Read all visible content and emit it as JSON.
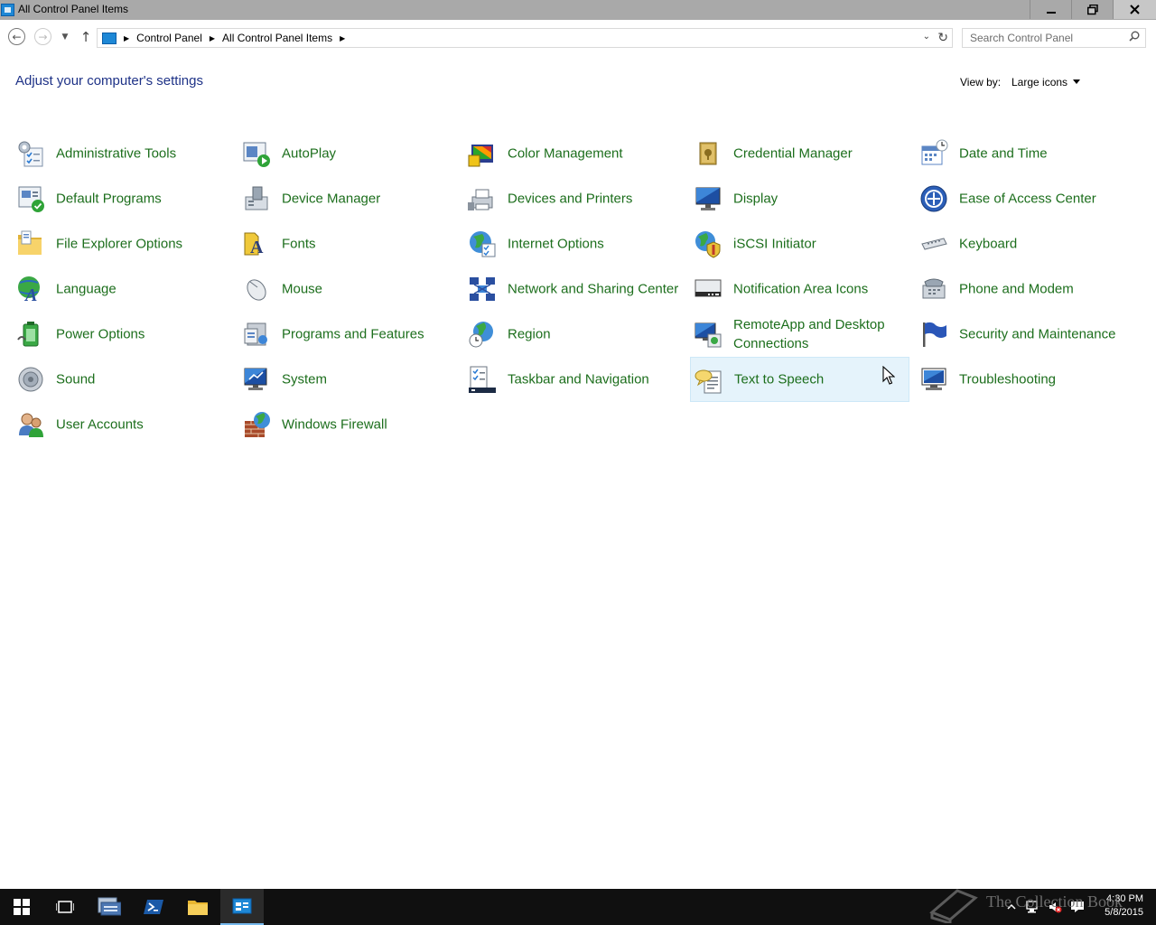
{
  "window": {
    "title": "All Control Panel Items",
    "minimize_glyph": "▁",
    "maximize_glyph": "❐",
    "close_glyph": "✕"
  },
  "address": {
    "crumbs": [
      "Control Panel",
      "All Control Panel Items"
    ],
    "search_placeholder": "Search Control Panel"
  },
  "header": {
    "title": "Adjust your computer's settings",
    "view_by_label": "View by:",
    "view_by_value": "Large icons"
  },
  "items": [
    {
      "label": "Administrative Tools",
      "icon": "administrative-tools-icon"
    },
    {
      "label": "AutoPlay",
      "icon": "autoplay-icon"
    },
    {
      "label": "Color Management",
      "icon": "color-management-icon"
    },
    {
      "label": "Credential Manager",
      "icon": "credential-manager-icon"
    },
    {
      "label": "Date and Time",
      "icon": "date-time-icon"
    },
    {
      "label": "Default Programs",
      "icon": "default-programs-icon"
    },
    {
      "label": "Device Manager",
      "icon": "device-manager-icon"
    },
    {
      "label": "Devices and Printers",
      "icon": "devices-printers-icon"
    },
    {
      "label": "Display",
      "icon": "display-icon"
    },
    {
      "label": "Ease of Access Center",
      "icon": "ease-of-access-icon"
    },
    {
      "label": "File Explorer Options",
      "icon": "file-explorer-options-icon"
    },
    {
      "label": "Fonts",
      "icon": "fonts-icon"
    },
    {
      "label": "Internet Options",
      "icon": "internet-options-icon"
    },
    {
      "label": "iSCSI Initiator",
      "icon": "iscsi-initiator-icon"
    },
    {
      "label": "Keyboard",
      "icon": "keyboard-icon"
    },
    {
      "label": "Language",
      "icon": "language-icon"
    },
    {
      "label": "Mouse",
      "icon": "mouse-icon"
    },
    {
      "label": "Network and Sharing Center",
      "icon": "network-sharing-icon"
    },
    {
      "label": "Notification Area Icons",
      "icon": "notification-area-icon"
    },
    {
      "label": "Phone and Modem",
      "icon": "phone-modem-icon"
    },
    {
      "label": "Power Options",
      "icon": "power-options-icon"
    },
    {
      "label": "Programs and Features",
      "icon": "programs-features-icon"
    },
    {
      "label": "Region",
      "icon": "region-icon"
    },
    {
      "label": "RemoteApp and Desktop Connections",
      "icon": "remoteapp-icon"
    },
    {
      "label": "Security and Maintenance",
      "icon": "security-maintenance-icon"
    },
    {
      "label": "Sound",
      "icon": "sound-icon"
    },
    {
      "label": "System",
      "icon": "system-icon"
    },
    {
      "label": "Taskbar and Navigation",
      "icon": "taskbar-navigation-icon"
    },
    {
      "label": "Text to Speech",
      "icon": "text-to-speech-icon",
      "hovered": true
    },
    {
      "label": "Troubleshooting",
      "icon": "troubleshooting-icon"
    },
    {
      "label": "User Accounts",
      "icon": "user-accounts-icon"
    },
    {
      "label": "Windows Firewall",
      "icon": "windows-firewall-icon"
    }
  ],
  "taskbar": {
    "time": "4:30 PM",
    "date": "5/8/2015",
    "watermark": "The Collection Book"
  },
  "colors": {
    "link_green": "#1c6e1c",
    "title_blue": "#1e3287",
    "titlebar": "#a9a9a9",
    "hover": "#e5f3fb"
  }
}
